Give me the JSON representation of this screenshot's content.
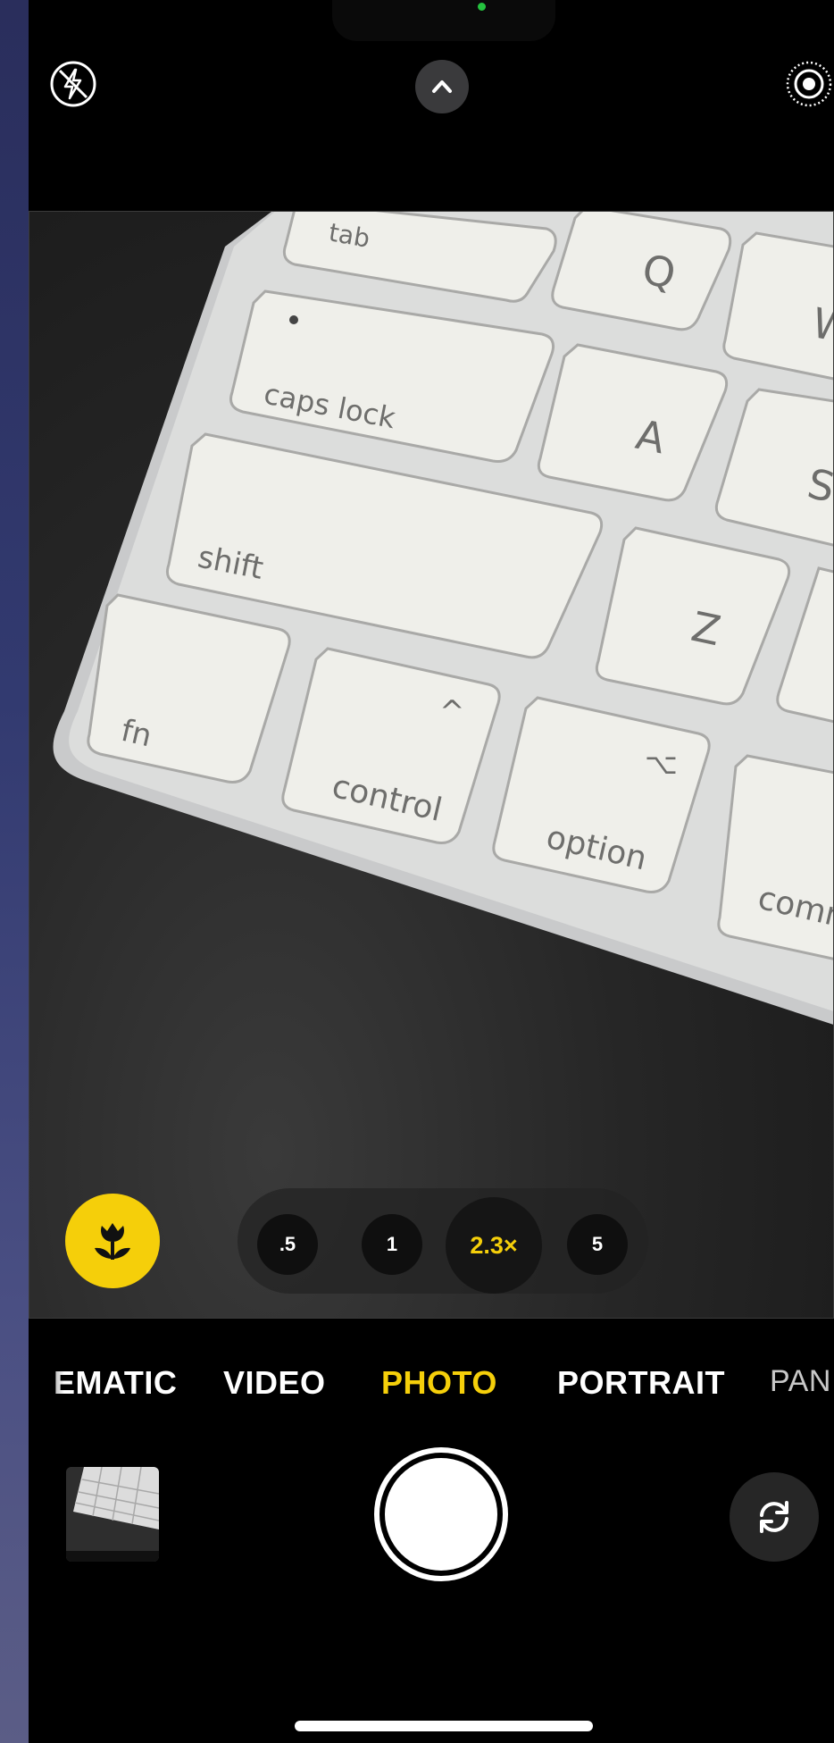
{
  "colors": {
    "accent": "#f5cf0a",
    "background": "#000000",
    "indicator": "#25c23f"
  },
  "top_bar": {
    "flash_icon": "flash-off-icon",
    "chevron_icon": "chevron-up-icon",
    "live_icon": "live-photo-icon"
  },
  "viewfinder": {
    "keys": [
      "tab",
      "Q",
      "W",
      "caps lock",
      "A",
      "S",
      "shift",
      "Z",
      "fn",
      "control",
      "option",
      "comm"
    ],
    "key_symbols": {
      "control": "^",
      "option": "⌥"
    }
  },
  "macro": {
    "icon": "flower-macro-icon"
  },
  "zoom": {
    "levels": [
      ".5",
      "1",
      "2.3×",
      "5"
    ],
    "selected": "2.3×"
  },
  "modes": {
    "items": [
      "EMATIC",
      "VIDEO",
      "PHOTO",
      "PORTRAIT",
      "PAN"
    ],
    "selected": "PHOTO"
  },
  "controls": {
    "thumbnail_icon": "last-photo-thumbnail",
    "shutter_icon": "shutter-button",
    "flip_icon": "camera-flip-icon"
  }
}
